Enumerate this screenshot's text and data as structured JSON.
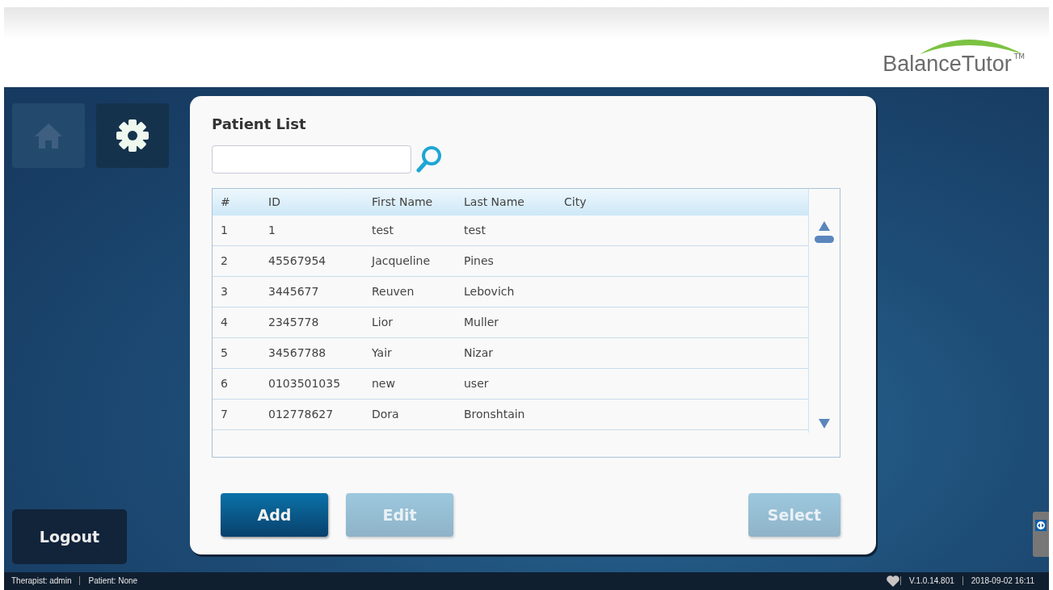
{
  "header": {
    "logo": "BalanceTutor",
    "trademark": "TM"
  },
  "nav": [
    {
      "kind": "home",
      "selected": false
    },
    {
      "kind": "settings",
      "selected": true
    }
  ],
  "logout": "Logout",
  "panel": {
    "title": "Patient List",
    "table": {
      "columns": [
        "#",
        "ID",
        "First Name",
        "Last Name",
        "City"
      ],
      "rows": [
        [
          "1",
          "1",
          "test",
          "test"
        ],
        [
          "2",
          "45567954",
          "Jacqueline",
          "Pines"
        ],
        [
          "3",
          "3445677",
          "Reuven",
          "Lebovich"
        ],
        [
          "4",
          "2345778",
          "Lior",
          "Muller"
        ],
        [
          "5",
          "34567788",
          "Yair",
          "Nizar"
        ],
        [
          "6",
          "0103501035",
          "new",
          "user"
        ],
        [
          "7",
          "012778627",
          "Dora",
          "Bronshtain"
        ]
      ]
    },
    "buttons": [
      {
        "label": "Add",
        "disabled": false
      },
      {
        "label": "Edit",
        "disabled": true
      },
      {
        "label": "Select",
        "disabled": true
      }
    ]
  },
  "status_bar": {
    "left": [
      "Therapist: admin",
      "Patient: None"
    ],
    "right": [
      "V.1.0.14.801",
      "2018-09-02 16:11"
    ]
  }
}
